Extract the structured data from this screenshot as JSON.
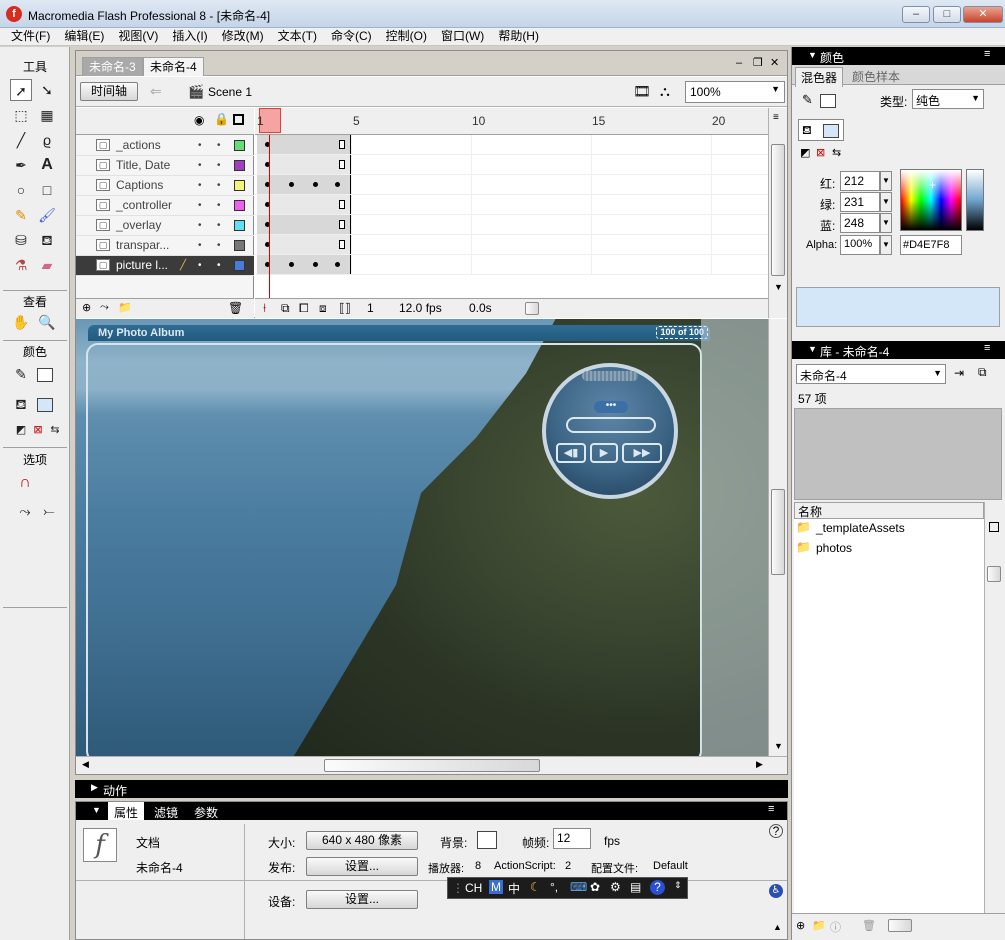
{
  "window": {
    "title": "Macromedia Flash Professional 8 - [未命名-4]",
    "min": "–",
    "max": "□",
    "close": "✕"
  },
  "menu": [
    "文件(F)",
    "编辑(E)",
    "视图(V)",
    "插入(I)",
    "修改(M)",
    "文本(T)",
    "命令(C)",
    "控制(O)",
    "窗口(W)",
    "帮助(H)"
  ],
  "tools": {
    "title": "工具",
    "view_title": "查看",
    "color_title": "颜色",
    "options_title": "选项"
  },
  "doc_tabs": [
    {
      "label": "未命名-3"
    },
    {
      "label": "未命名-4"
    }
  ],
  "editbar": {
    "timeline_btn": "时间轴",
    "scene": "Scene 1",
    "zoom": "100%"
  },
  "timeline": {
    "layers": [
      {
        "name": "_actions",
        "color": "#66dd77"
      },
      {
        "name": "Title, Date",
        "color": "#a040c0"
      },
      {
        "name": "Captions",
        "color": "#f4f47a"
      },
      {
        "name": "_controller",
        "color": "#f060f0"
      },
      {
        "name": "_overlay",
        "color": "#60e0f0"
      },
      {
        "name": "transpar...",
        "color": "#777777"
      },
      {
        "name": "picture l...",
        "color": "#4a7bd8"
      }
    ],
    "frame_numbers": [
      "1",
      "5",
      "10",
      "15",
      "20"
    ],
    "status": {
      "frame": "1",
      "fps": "12.0 fps",
      "time": "0.0s"
    }
  },
  "stage": {
    "album_title": "My Photo Album",
    "album_count": "100 of 100"
  },
  "actions_panel": {
    "label": "动作"
  },
  "properties": {
    "tabs": [
      "属性",
      "滤镜",
      "参数"
    ],
    "doc_type": "文档",
    "doc_name": "未命名-4",
    "size_label": "大小:",
    "size_value": "640 x 480 像素",
    "bg_label": "背景:",
    "fps_label": "帧频:",
    "fps_value": "12",
    "fps_unit": "fps",
    "publish_label": "发布:",
    "settings_btn": "设置...",
    "player_label": "播放器:",
    "player_value": "8",
    "as_label": "ActionScript:",
    "as_value": "2",
    "profile_label": "配置文件:",
    "profile_value": "Default",
    "device_label": "设备:",
    "device_btn": "设置..."
  },
  "ime": {
    "lang": "CH",
    "mode": "中"
  },
  "color_panel": {
    "title": "颜色",
    "tabs": [
      "混色器",
      "颜色样本"
    ],
    "type_label": "类型:",
    "type_value": "纯色",
    "r_label": "红:",
    "r_value": "212",
    "g_label": "绿:",
    "g_value": "231",
    "b_label": "蓝:",
    "b_value": "248",
    "alpha_label": "Alpha:",
    "alpha_value": "100%",
    "hex_value": "#D4E7F8",
    "preview_color": "#D4E7F8"
  },
  "library_panel": {
    "title": "库 - 未命名-4",
    "doc_select": "未命名-4",
    "count": "57 项",
    "col_name": "名称",
    "items": [
      {
        "name": "_templateAssets"
      },
      {
        "name": "photos"
      }
    ]
  }
}
